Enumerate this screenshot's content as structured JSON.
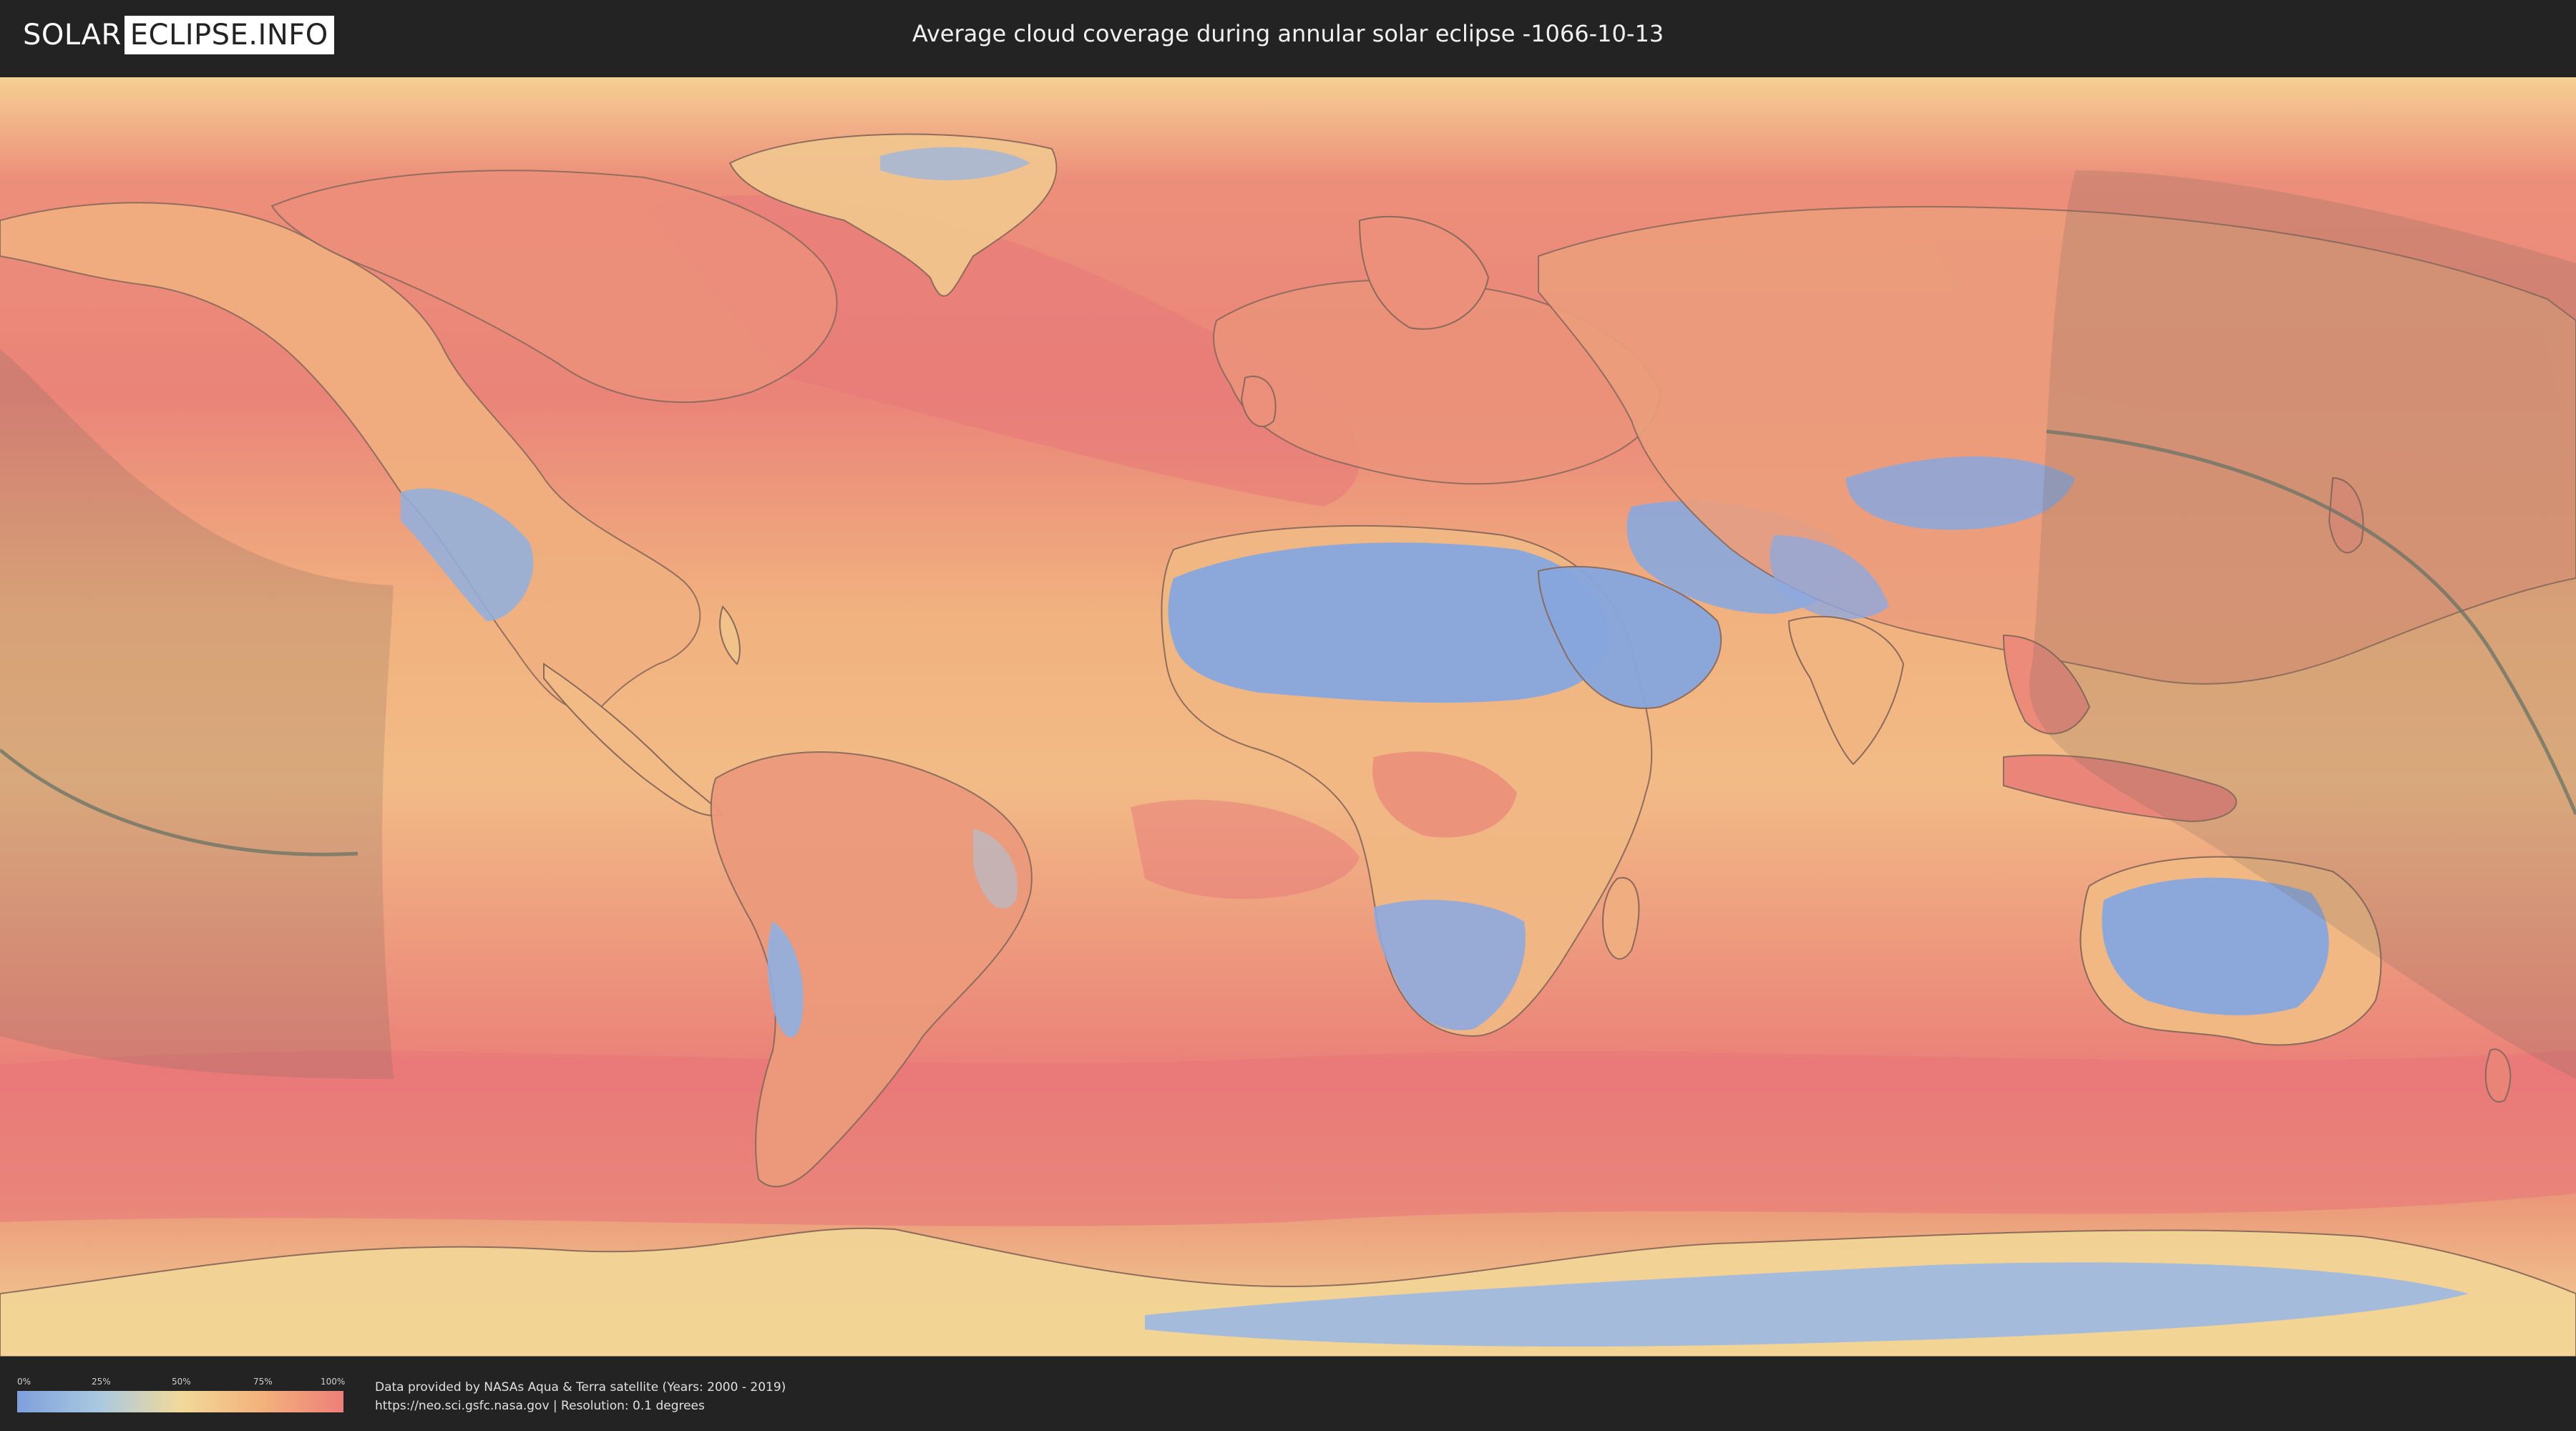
{
  "header": {
    "logo_part1": "SOLAR",
    "logo_part2": "ECLIPSE.INFO",
    "title": "Average cloud coverage during annular solar eclipse -1066-10-13"
  },
  "legend": {
    "ticks": [
      "0%",
      "25%",
      "50%",
      "75%",
      "100%"
    ],
    "colors": [
      "#7f9fdc",
      "#a9c9e1",
      "#f2d99a",
      "#f3b27c",
      "#ee7f7a"
    ]
  },
  "credits": {
    "line1": "Data provided by NASAs Aqua & Terra satellite (Years: 2000 - 2019)",
    "line2": "https://neo.sci.gsfc.nasa.gov | Resolution: 0.1 degrees"
  },
  "map": {
    "colors": {
      "ocean_base": "#eca77b",
      "cloudy": "#ea7d78",
      "clear": "#8ea9de",
      "eclipse_shade": "#7a6a5a",
      "central_line": "#6e7566"
    }
  }
}
